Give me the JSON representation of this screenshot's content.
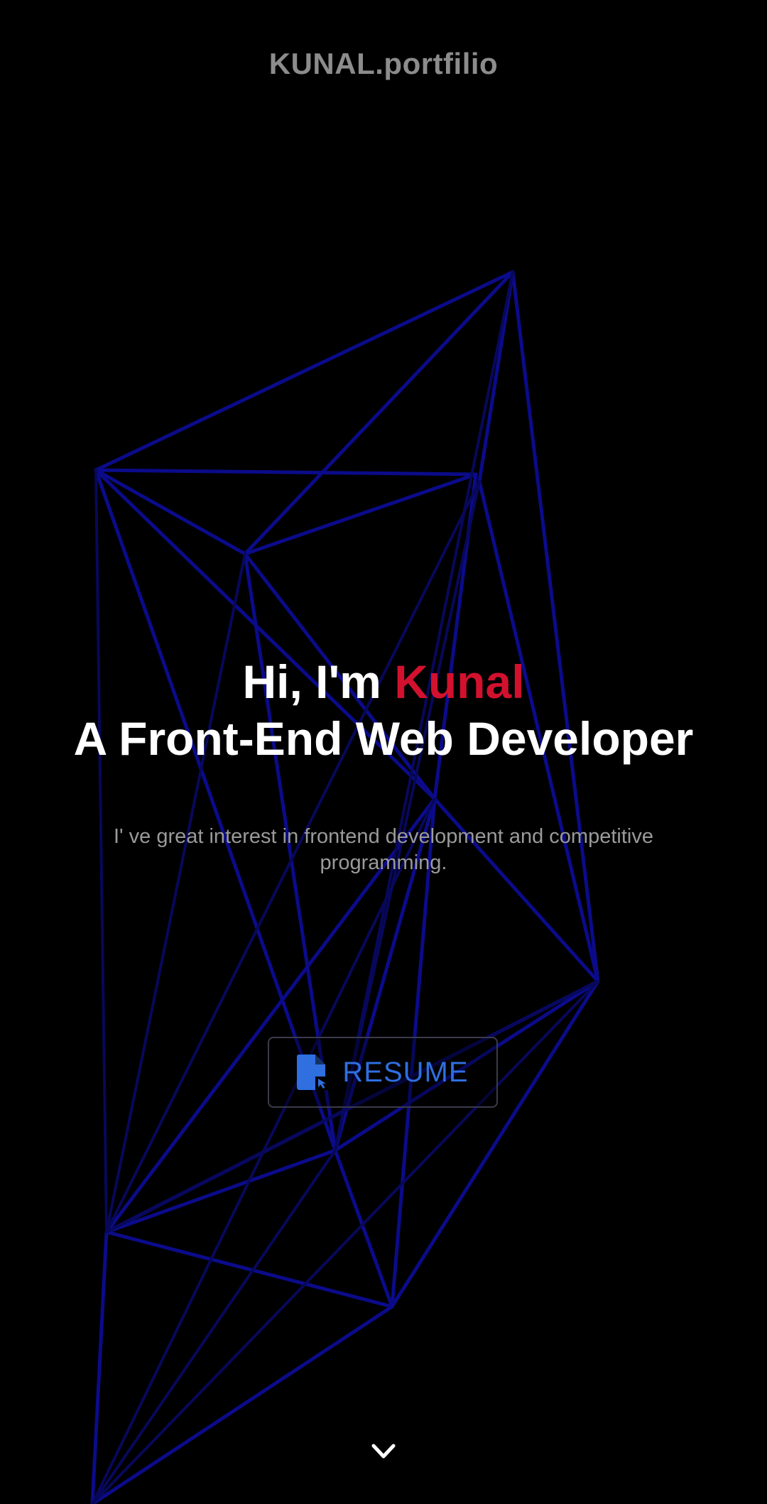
{
  "header": {
    "brand": "KUNAL.portfilio"
  },
  "hero": {
    "greeting_prefix": "Hi, I'm",
    "name": "Kunal",
    "role": "A Front-End Web Developer"
  },
  "intro": {
    "text": "I' ve great interest in frontend development and competitive programming."
  },
  "actions": {
    "resume_label": "RESUME",
    "resume_icon": "file-download-icon"
  },
  "navigation": {
    "scroll_icon": "chevron-down-icon"
  },
  "colors": {
    "background": "#000000",
    "accent": "#d2112e",
    "button_text": "#2f6fe0",
    "network_lines": "#0b0b8a"
  }
}
